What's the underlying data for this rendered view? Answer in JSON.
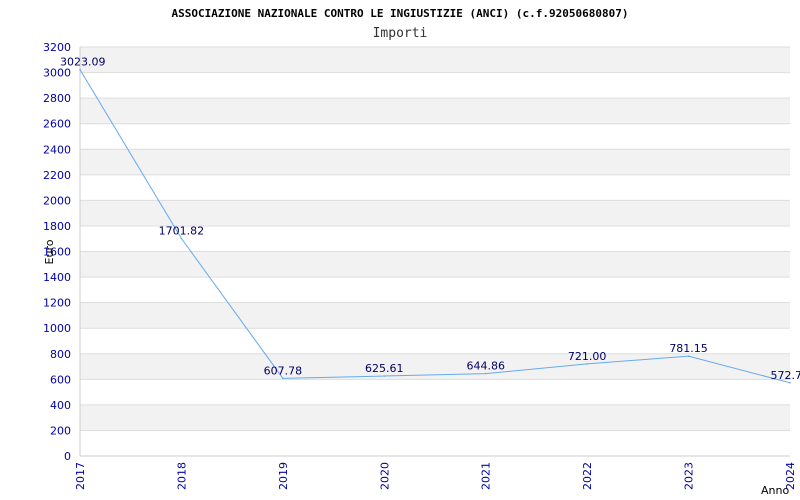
{
  "chart_data": {
    "type": "line",
    "title": "ASSOCIAZIONE NAZIONALE CONTRO LE INGIUSTIZIE (ANCI) (c.f.92050680807)",
    "subtitle": "Importi",
    "xlabel": "Anno",
    "ylabel": "Euro",
    "ylim": [
      0,
      3200
    ],
    "yticks": [
      0,
      200,
      400,
      600,
      800,
      1000,
      1200,
      1400,
      1600,
      1800,
      2000,
      2200,
      2400,
      2600,
      2800,
      3000,
      3200
    ],
    "categories": [
      "2017",
      "2018",
      "2019",
      "2020",
      "2021",
      "2022",
      "2023",
      "2024"
    ],
    "series": [
      {
        "values": [
          3023.09,
          1701.82,
          607.78,
          625.61,
          644.86,
          721.0,
          781.15,
          572.7
        ],
        "labels": [
          "3023.09",
          "1701.82",
          "607.78",
          "625.61",
          "644.86",
          "721.00",
          "781.15",
          "572.7"
        ],
        "color": "#66aaee"
      }
    ],
    "grid": true,
    "band_colors": [
      "#f2f2f2",
      "#ffffff"
    ],
    "legend": "none"
  }
}
